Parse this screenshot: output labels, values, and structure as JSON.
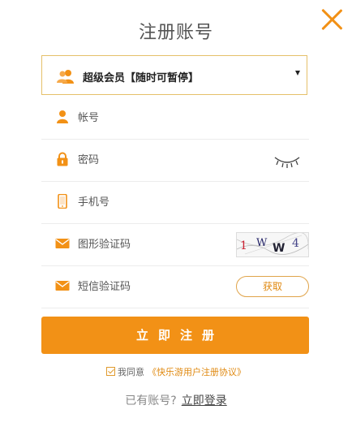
{
  "title": "注册账号",
  "member": {
    "label": "超级会员【随时可暂停】"
  },
  "fields": {
    "account_placeholder": "帐号",
    "password_placeholder": "密码",
    "phone_placeholder": "手机号",
    "captcha_placeholder": "图形验证码",
    "sms_placeholder": "短信验证码"
  },
  "captcha_text": "1 W W 4",
  "get_code_label": "获取",
  "submit_label": "立即注册",
  "agreement": {
    "prefix": "我同意",
    "link": "《快乐游用户注册协议》",
    "checked": true
  },
  "login": {
    "prompt": "已有账号?",
    "link": "立即登录"
  },
  "colors": {
    "accent": "#f29116",
    "border": "#e5c06a"
  },
  "icons": [
    "close-icon",
    "users-icon",
    "user-icon",
    "lock-icon",
    "phone-icon",
    "mail-icon",
    "eye-closed-icon"
  ]
}
